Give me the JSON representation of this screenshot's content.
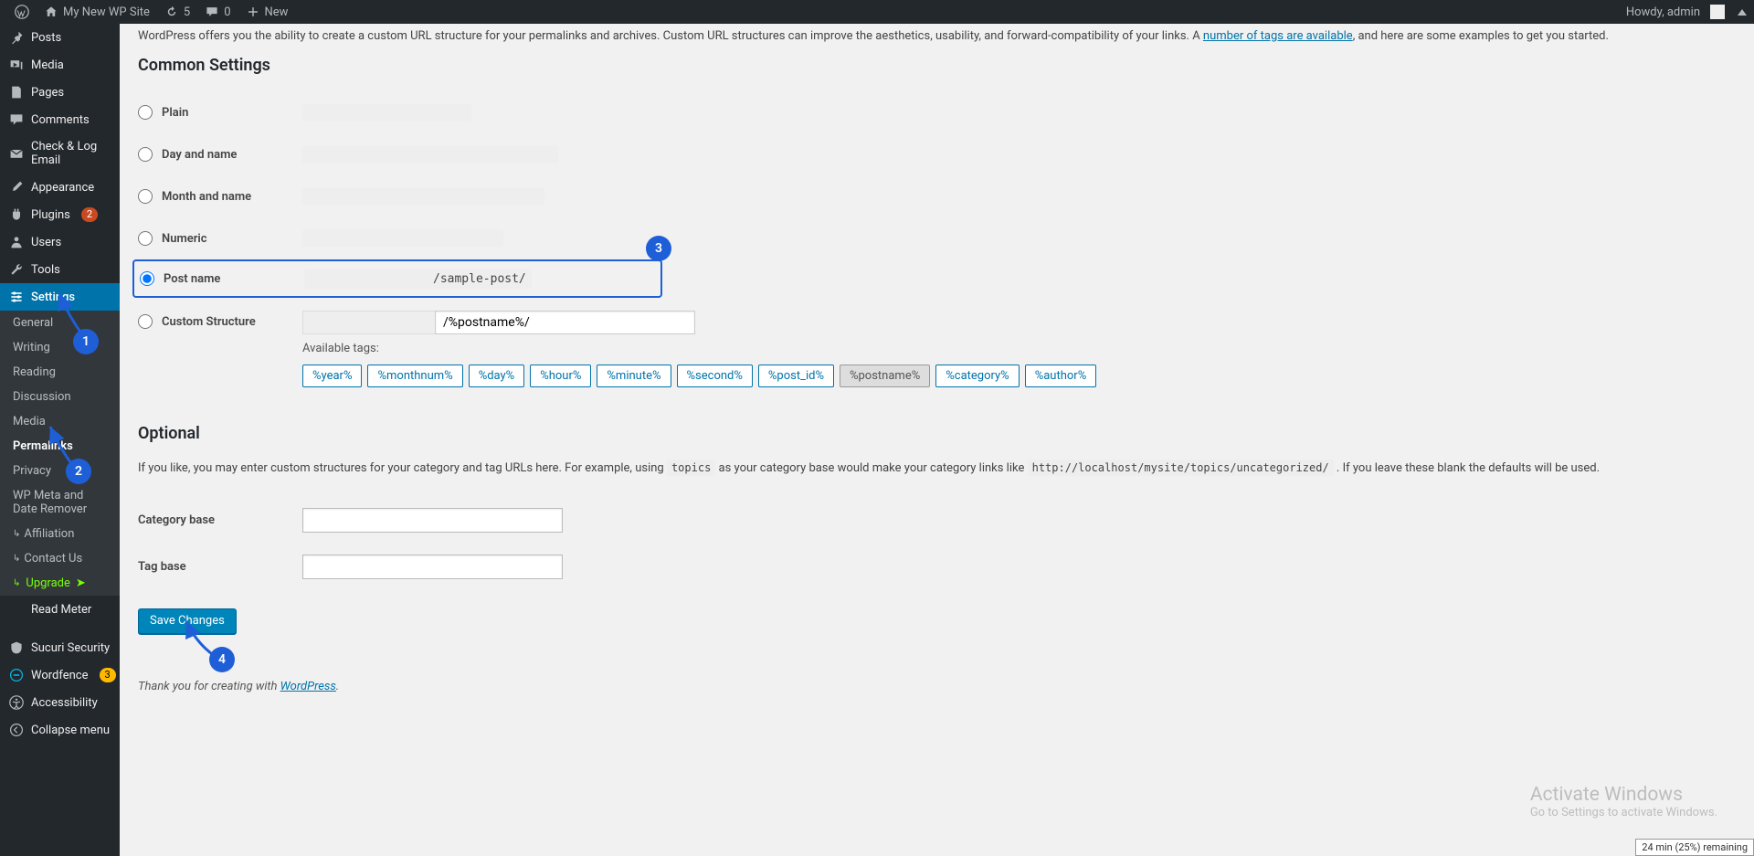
{
  "adminbar": {
    "site_name": "My New WP Site",
    "refresh_count": "5",
    "comments_count": "0",
    "new_label": "New",
    "howdy": "Howdy, admin"
  },
  "sidebar": {
    "items": [
      {
        "label": "Posts",
        "icon": "pin-icon"
      },
      {
        "label": "Media",
        "icon": "media-icon"
      },
      {
        "label": "Pages",
        "icon": "page-icon"
      },
      {
        "label": "Comments",
        "icon": "comment-icon"
      },
      {
        "label": "Check & Log Email",
        "icon": "mail-icon"
      },
      {
        "label": "Appearance",
        "icon": "brush-icon"
      },
      {
        "label": "Plugins",
        "icon": "plug-icon",
        "badge": "2"
      },
      {
        "label": "Users",
        "icon": "user-icon"
      },
      {
        "label": "Tools",
        "icon": "wrench-icon"
      },
      {
        "label": "Settings",
        "icon": "settings-icon",
        "current": true
      }
    ],
    "submenu": [
      {
        "label": "General"
      },
      {
        "label": "Writing"
      },
      {
        "label": "Reading"
      },
      {
        "label": "Discussion"
      },
      {
        "label": "Media"
      },
      {
        "label": "Permalinks",
        "active": true
      },
      {
        "label": "Privacy"
      },
      {
        "label": "WP Meta and Date Remover"
      },
      {
        "label": "Affiliation",
        "indent": true
      },
      {
        "label": "Contact Us",
        "indent": true
      },
      {
        "label": "Upgrade",
        "upgrade": true
      }
    ],
    "tail": [
      {
        "label": "Read Meter",
        "icon": ""
      },
      {
        "label": "Sucuri Security",
        "icon": "shield-icon"
      },
      {
        "label": "Wordfence",
        "icon": "wf-icon",
        "badge": "3",
        "badge_class": "yellow"
      },
      {
        "label": "Accessibility",
        "icon": "a11y-icon"
      },
      {
        "label": "Collapse menu",
        "icon": "collapse-icon"
      }
    ]
  },
  "content": {
    "intro_before": "WordPress offers you the ability to create a custom URL structure for your permalinks and archives. Custom URL structures can improve the aesthetics, usability, and forward-compatibility of your links. A ",
    "intro_link": "number of tags are available",
    "intro_after": ", and here are some examples to get you started.",
    "h2_common": "Common Settings",
    "radios": {
      "plain": "Plain",
      "dayname": "Day and name",
      "monthname": "Month and name",
      "numeric": "Numeric",
      "postname": "Post name",
      "postname_suffix": "/sample-post/",
      "custom": "Custom Structure",
      "custom_value": "/%postname%/"
    },
    "available_tags_label": "Available tags:",
    "tags": [
      "%year%",
      "%monthnum%",
      "%day%",
      "%hour%",
      "%minute%",
      "%second%",
      "%post_id%",
      "%postname%",
      "%category%",
      "%author%"
    ],
    "active_tag": "%postname%",
    "h2_optional": "Optional",
    "optional_before": "If you like, you may enter custom structures for your category and tag URLs here. For example, using ",
    "optional_code1": "topics",
    "optional_mid": " as your category base would make your category links like ",
    "optional_code2": "http://localhost/mysite/topics/uncategorized/",
    "optional_after": " . If you leave these blank the defaults will be used.",
    "category_base_label": "Category base",
    "tag_base_label": "Tag base",
    "save_label": "Save Changes",
    "footer_before": "Thank you for creating with ",
    "footer_link": "WordPress",
    "footer_after": "."
  },
  "callouts": {
    "c1": "1",
    "c2": "2",
    "c3": "3",
    "c4": "4"
  },
  "watermark": {
    "title": "Activate Windows",
    "sub": "Go to Settings to activate Windows."
  },
  "battery": "24 min (25%) remaining"
}
